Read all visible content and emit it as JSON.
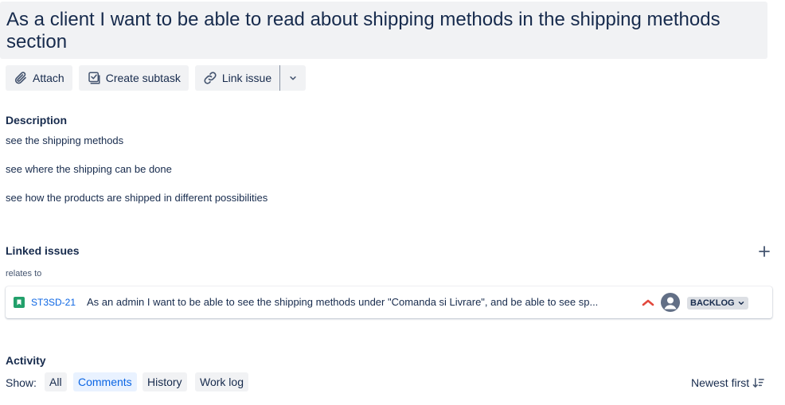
{
  "issue": {
    "title": "As a client I want to be able to read about shipping methods in the shipping methods section"
  },
  "toolbar": {
    "attach_label": "Attach",
    "create_subtask_label": "Create subtask",
    "link_issue_label": "Link issue"
  },
  "description": {
    "heading": "Description",
    "lines": [
      "see the shipping methods",
      "see where the shipping can be done",
      "see how the products are shipped in different possibilities"
    ]
  },
  "linked_issues": {
    "heading": "Linked issues",
    "relation": "relates to",
    "items": [
      {
        "key": "ST3SD-21",
        "summary": "As an admin I want to be able to see the shipping methods under \"Comanda si Livrare\", and be able to see sp...",
        "status": "BACKLOG",
        "priority_color": "#e2483d",
        "type_color": "#22a06b"
      }
    ]
  },
  "activity": {
    "heading": "Activity",
    "show_label": "Show:",
    "filters": [
      "All",
      "Comments",
      "History",
      "Work log"
    ],
    "active_filter": "Comments",
    "sort_label": "Newest first"
  }
}
